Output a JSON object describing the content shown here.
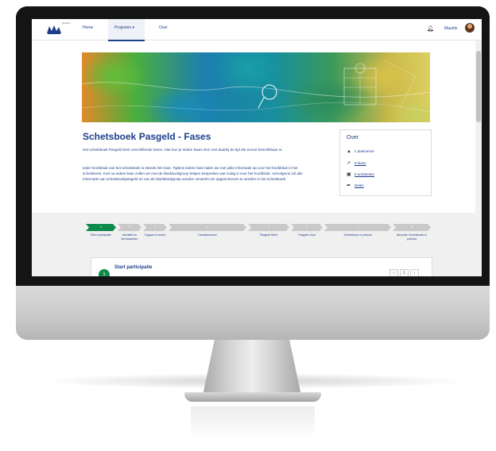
{
  "nav": {
    "logo_caption": "Heerlen",
    "items": [
      "Home",
      "Projecten",
      "Over"
    ],
    "projecten_chevron": "▾",
    "user_name": "Maurits"
  },
  "page": {
    "title": "Schetsboek Pasgeld - Fases",
    "intro": "Het schetsboek Pasgeld kent verschillende fases. Hier kun je iedere fases zien met daarbij de tijd die ervoor beschikbaar is.",
    "body": "Ieder hoofdstuk van het schetsboek is steeds één fase. Tijdens iedere fase halen we met jullie informatie op voor het hoofdstuk in het schetsboek. Kort na iedere fase zullen we met de klankbordgroep helpen bespreken wat nodig is voor het hoofdstuk. Vervolgens zal alle informatie van schetsboekpasgeld en van de klankbordgroep worden verwerkt om opgeschreven te worden in het schetsboek."
  },
  "over": {
    "title": "Over",
    "rows": [
      {
        "icon": "person-icon",
        "text": "1 deelnemer",
        "link": false
      },
      {
        "icon": "chart-icon",
        "text": "6 fases",
        "link": true
      },
      {
        "icon": "calendar-icon",
        "text": "8 activiteiten",
        "link": true
      },
      {
        "icon": "share-icon",
        "text": "Delen",
        "link": true
      }
    ]
  },
  "steps": [
    {
      "num": "1",
      "label": "Start participatie",
      "active": true
    },
    {
      "num": "2",
      "label": "Identiteit en kernwaarden",
      "active": false
    },
    {
      "num": "3",
      "label": "Opgave in beeld",
      "active": false
    },
    {
      "num": "4",
      "label": "Hoofdstructuur",
      "active": false
    },
    {
      "num": "5",
      "label": "Pasgeld West",
      "active": false
    },
    {
      "num": "6",
      "label": "Pasgeld Oost",
      "active": false
    },
    {
      "num": "7",
      "label": "Schetsboek in potlood",
      "active": false
    },
    {
      "num": "8",
      "label": "Afronden Schetsboek in potlood",
      "active": false
    }
  ],
  "card": {
    "number": "1",
    "title": "Start participatie",
    "pager": [
      "‹",
      "1",
      "›"
    ]
  },
  "colors": {
    "brand": "#1f3f8a",
    "active_step": "#0e8a4a",
    "inactive_step": "#c9c9c9"
  }
}
